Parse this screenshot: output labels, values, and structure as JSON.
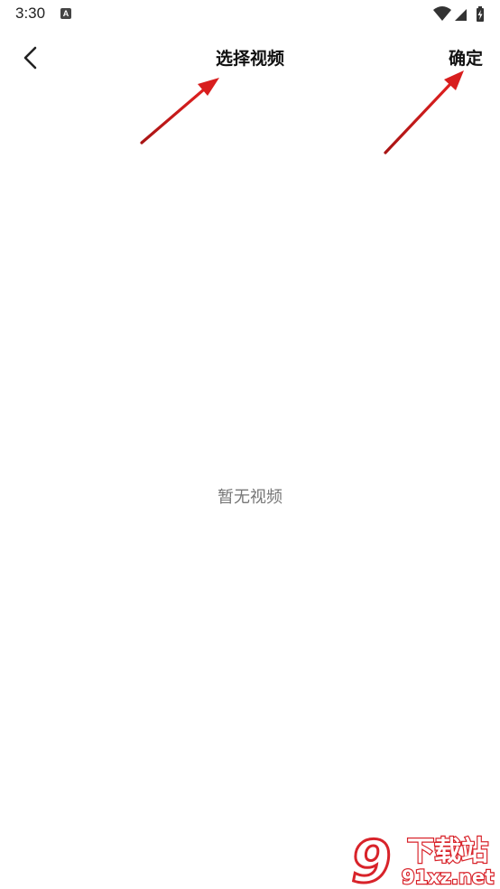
{
  "status_bar": {
    "time": "3:30",
    "notification_letter": "A",
    "icons": [
      "wifi-icon",
      "signal-icon",
      "battery-charging-icon"
    ]
  },
  "header": {
    "title": "选择视频",
    "confirm_label": "确定",
    "back_icon": "chevron-left-icon"
  },
  "main": {
    "empty_text": "暂无视频"
  },
  "watermark": {
    "text_top": "下载站",
    "text_bottom": "91xz.net",
    "number": "9",
    "color": "#d8232a"
  },
  "annotation_color": "#cc1f1f"
}
